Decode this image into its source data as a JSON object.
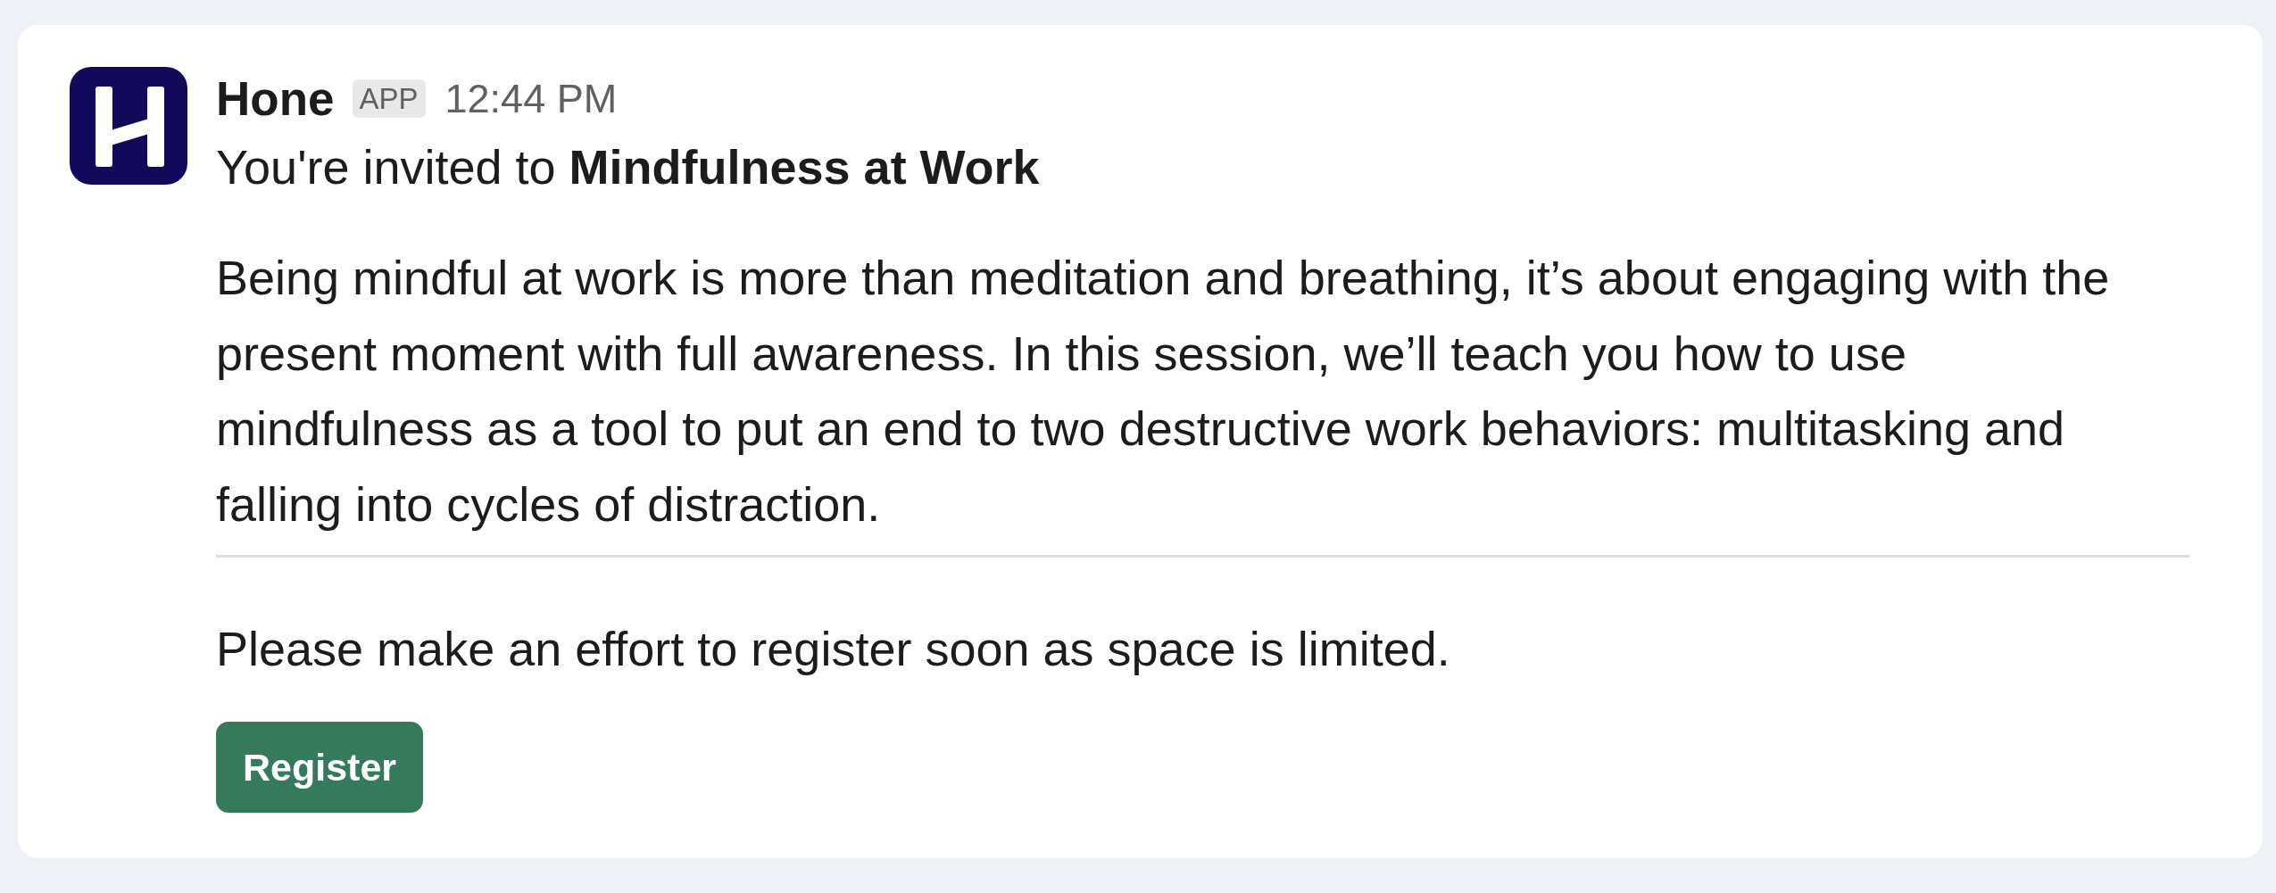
{
  "message": {
    "sender": "Hone",
    "badge": "APP",
    "time": "12:44 PM",
    "title": "You're invited to **Mindfulness at Work**",
    "description": "Being mindful at work is more than meditation and breathing, it’s about engaging with the present moment with full awareness. In this session, we’ll teach you how to use mindfulness as a tool to put an end to two destructive work behaviors: multitasking and falling into cycles of distraction.",
    "note": "Please make an effort to register soon as space is limited.",
    "buttons": [
      {
        "label": "Register"
      }
    ]
  }
}
